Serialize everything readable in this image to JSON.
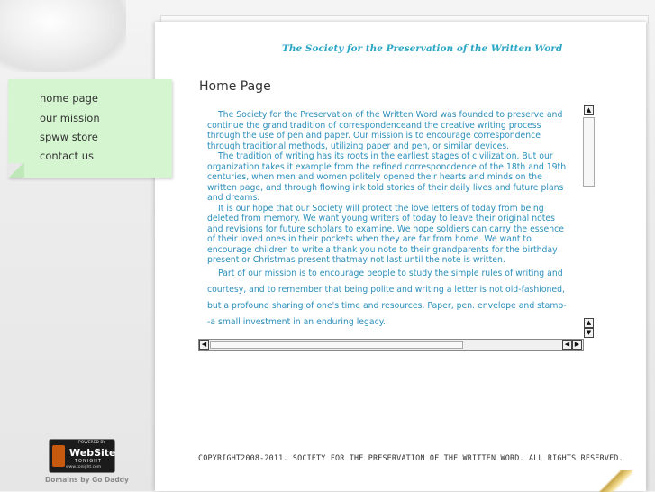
{
  "site": {
    "title": "The Society for the Preservation of the Written Word"
  },
  "nav": {
    "items": [
      {
        "label": "home page"
      },
      {
        "label": "our mission"
      },
      {
        "label": "spww store"
      },
      {
        "label": "contact us"
      }
    ]
  },
  "main": {
    "heading": "Home Page",
    "paragraphs": [
      "The Society for the Preservation of the Written Word was founded to preserve and continue the grand tradition of correspondenceand the creative writing process through the use of pen and paper.  Our mission is to encourage correspondence through traditional methods, utilizing paper and pen, or similar devices.",
      "The tradition of writing has its roots in the earliest stages of civilization.  But our organization takes it example from the refined corresponcdence of the 18th and 19th centuries, when men and women politely opened their hearts and minds on the written page, and through flowing ink told stories of their daily lives and future plans and dreams.",
      "It is our hope that our Society will protect the love letters of today from being deleted from memory.  We want young writers of today to leave their original notes and revisions for future scholars to examine.  We hope soldiers can carry the essence of their loved ones in their pockets when they are far from home.  We want to encourage children to write a thank you note to their grandparents for the birthday present or Christmas present thatmay not last until the note is written.",
      "Part of our mission is to encourage people to study the simple rules of writing and courtesy, and to remember that being polite and writing  a letter is not old-fashioned, but a profound sharing of one's time and resources.  Paper, pen. envelope and stamp--a small investment in an enduring legacy."
    ]
  },
  "footer": {
    "copyright": "COPYRIGHT2008-2011. SOCIETY FOR THE PRESERVATION OF THE WRITTEN WORD. ALL RIGHTS RESERVED."
  },
  "badge": {
    "powered_by": "POWERED BY",
    "title": "WebSite",
    "subtitle": "TONIGHT",
    "url": "www.tonight.com",
    "caption": "Domains by Go Daddy"
  },
  "icons": {
    "scroll_up": "triangle-up",
    "scroll_down": "triangle-down",
    "scroll_left": "triangle-left",
    "scroll_right": "triangle-right"
  },
  "colors": {
    "title": "#2aa6c4",
    "content_text": "#2b8fbb",
    "sticky_note": "#d4f5cf"
  }
}
